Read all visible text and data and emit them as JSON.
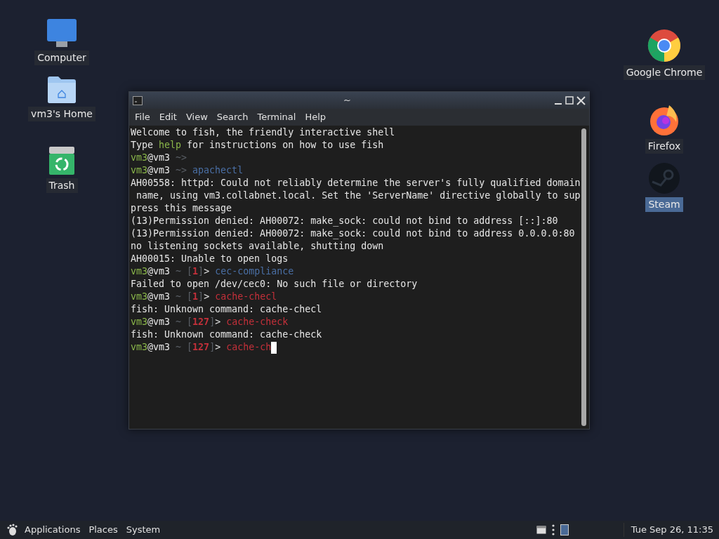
{
  "desktop_icons_left": [
    {
      "label": "Computer",
      "kind": "computer",
      "selected": false
    },
    {
      "label": "vm3's Home",
      "kind": "home",
      "selected": false
    },
    {
      "label": "Trash",
      "kind": "trash",
      "selected": false
    }
  ],
  "desktop_icons_right": [
    {
      "label": "Google Chrome",
      "kind": "chrome",
      "selected": false
    },
    {
      "label": "Firefox",
      "kind": "firefox",
      "selected": false
    },
    {
      "label": "Steam",
      "kind": "steam",
      "selected": true
    }
  ],
  "window": {
    "title": "~",
    "menu": [
      "File",
      "Edit",
      "View",
      "Search",
      "Terminal",
      "Help"
    ],
    "lines": [
      [
        {
          "text": "Welcome to fish, the friendly interactive shell",
          "kind": "plain"
        }
      ],
      [
        {
          "text": "Type ",
          "kind": "plain"
        },
        {
          "text": "help",
          "kind": "user"
        },
        {
          "text": " for instructions on how to use fish",
          "kind": "plain"
        }
      ],
      [
        {
          "text": "vm3",
          "kind": "user"
        },
        {
          "text": "@vm3 ",
          "kind": "plain"
        },
        {
          "text": "~>",
          "kind": "dim"
        }
      ],
      [
        {
          "text": "vm3",
          "kind": "user"
        },
        {
          "text": "@vm3 ",
          "kind": "plain"
        },
        {
          "text": "~>",
          "kind": "dim"
        },
        {
          "text": " apachectl",
          "kind": "command"
        }
      ],
      [
        {
          "text": "AH00558: httpd: Could not reliably determine the server's fully qualified domain",
          "kind": "plain"
        }
      ],
      [
        {
          "text": " name, using vm3.collabnet.local. Set the 'ServerName' directive globally to sup",
          "kind": "plain"
        }
      ],
      [
        {
          "text": "press this message",
          "kind": "plain"
        }
      ],
      [
        {
          "text": "(13)Permission denied: AH00072: make_sock: could not bind to address [::]:80",
          "kind": "plain"
        }
      ],
      [
        {
          "text": "(13)Permission denied: AH00072: make_sock: could not bind to address 0.0.0.0:80",
          "kind": "plain"
        }
      ],
      [
        {
          "text": "no listening sockets available, shutting down",
          "kind": "plain"
        }
      ],
      [
        {
          "text": "AH00015: Unable to open logs",
          "kind": "plain"
        }
      ],
      [
        {
          "text": "vm3",
          "kind": "user"
        },
        {
          "text": "@vm3 ",
          "kind": "plain"
        },
        {
          "text": "~ [",
          "kind": "dim"
        },
        {
          "text": "1",
          "kind": "status"
        },
        {
          "text": "]",
          "kind": "dim"
        },
        {
          "text": "> ",
          "kind": "plain"
        },
        {
          "text": "cec-compliance",
          "kind": "command"
        }
      ],
      [
        {
          "text": "Failed to open /dev/cec0: No such file or directory",
          "kind": "plain"
        }
      ],
      [
        {
          "text": "vm3",
          "kind": "user"
        },
        {
          "text": "@vm3 ",
          "kind": "plain"
        },
        {
          "text": "~ [",
          "kind": "dim"
        },
        {
          "text": "1",
          "kind": "status"
        },
        {
          "text": "]",
          "kind": "dim"
        },
        {
          "text": "> ",
          "kind": "plain"
        },
        {
          "text": "cache-checl",
          "kind": "error"
        }
      ],
      [
        {
          "text": "fish: Unknown command: cache-checl",
          "kind": "plain"
        }
      ],
      [
        {
          "text": "vm3",
          "kind": "user"
        },
        {
          "text": "@vm3 ",
          "kind": "plain"
        },
        {
          "text": "~ [",
          "kind": "dim"
        },
        {
          "text": "127",
          "kind": "status"
        },
        {
          "text": "]",
          "kind": "dim"
        },
        {
          "text": "> ",
          "kind": "plain"
        },
        {
          "text": "cache-check",
          "kind": "error"
        }
      ],
      [
        {
          "text": "fish: Unknown command: cache-check",
          "kind": "plain"
        }
      ],
      [
        {
          "text": "vm3",
          "kind": "user"
        },
        {
          "text": "@vm3 ",
          "kind": "plain"
        },
        {
          "text": "~ [",
          "kind": "dim"
        },
        {
          "text": "127",
          "kind": "status"
        },
        {
          "text": "]",
          "kind": "dim"
        },
        {
          "text": "> ",
          "kind": "plain"
        },
        {
          "text": "cache-ch",
          "kind": "error"
        }
      ]
    ]
  },
  "panel": {
    "menus": [
      "Applications",
      "Places",
      "System"
    ],
    "clock": "Tue Sep 26, 11:35"
  }
}
